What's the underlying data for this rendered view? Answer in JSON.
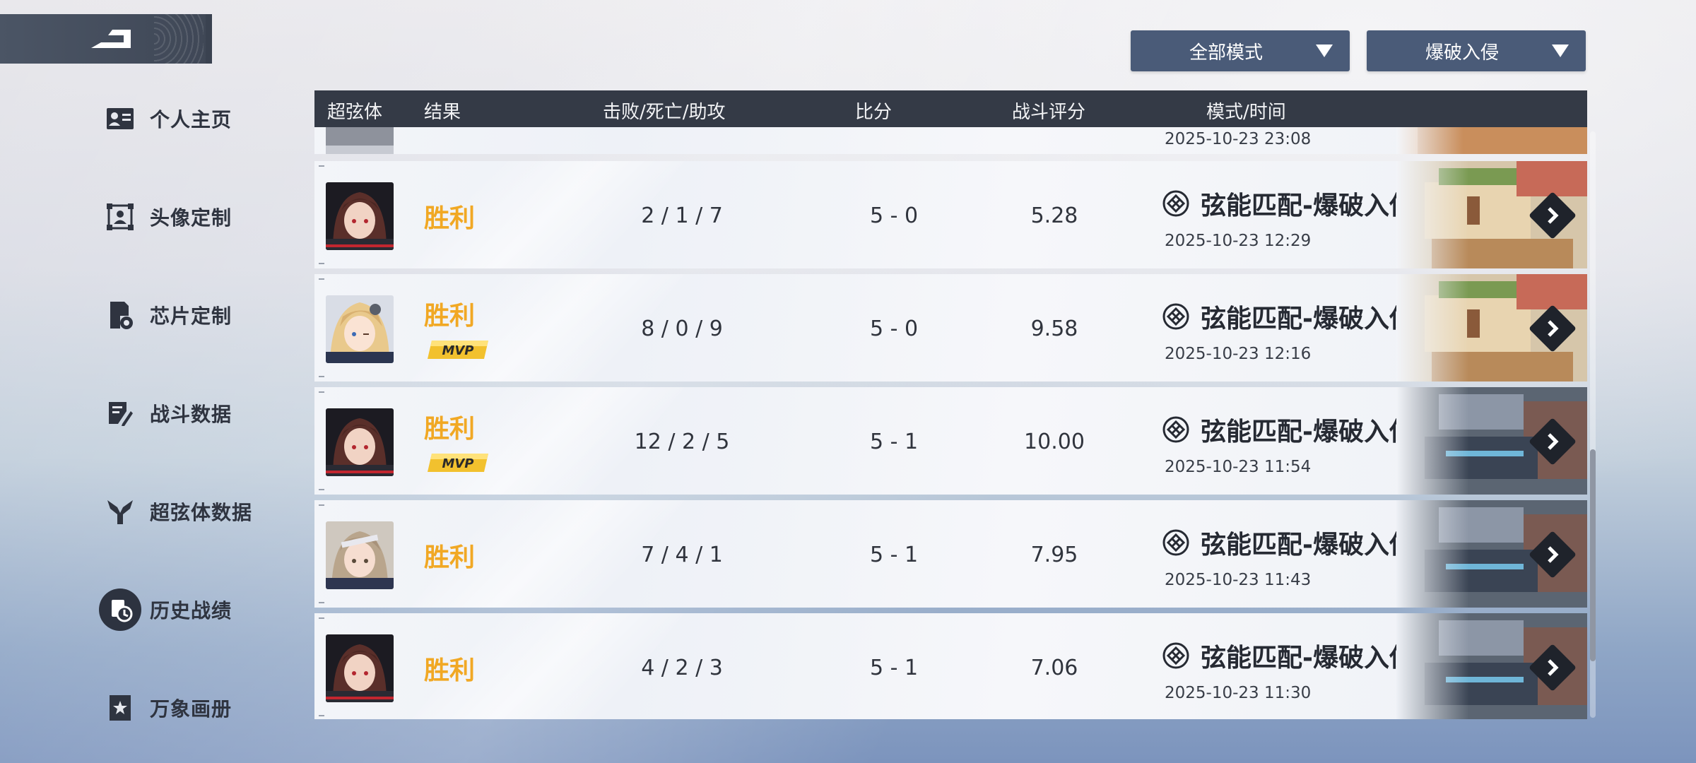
{
  "nav": {
    "back_icon": "back-arrow-icon",
    "items": [
      {
        "label": "个人主页",
        "icon": "profile-card-icon"
      },
      {
        "label": "头像定制",
        "icon": "avatar-frame-icon"
      },
      {
        "label": "芯片定制",
        "icon": "chip-gear-icon"
      },
      {
        "label": "战斗数据",
        "icon": "battle-data-icon"
      },
      {
        "label": "超弦体数据",
        "icon": "character-icon"
      },
      {
        "label": "历史战绩",
        "icon": "history-clock-icon",
        "active": true
      },
      {
        "label": "万象画册",
        "icon": "album-star-icon"
      }
    ]
  },
  "filters": {
    "mode": "全部模式",
    "type": "爆破入侵"
  },
  "table": {
    "headers": {
      "character": "超弦体",
      "result": "结果",
      "kda": "击败/死亡/助攻",
      "score": "比分",
      "rating": "战斗评分",
      "mode_time": "模式/时间"
    },
    "partial_row_time": "2025-10-23 23:08",
    "rows": [
      {
        "result": "胜利",
        "mvp": false,
        "kda": "2 / 1 / 7",
        "score": "5 - 0",
        "rating": "5.28",
        "mode": "弦能匹配-爆破入侵",
        "time": "2025-10-23 12:29",
        "map": "bright",
        "avatar": "dark-hair"
      },
      {
        "result": "胜利",
        "mvp": true,
        "mvp_label": "MVP",
        "kda": "8 / 0 / 9",
        "score": "5 - 0",
        "rating": "9.58",
        "mode": "弦能匹配-爆破入侵",
        "time": "2025-10-23 12:16",
        "map": "bright",
        "avatar": "blonde"
      },
      {
        "result": "胜利",
        "mvp": true,
        "mvp_label": "MVP",
        "kda": "12 / 2 / 5",
        "score": "5 - 1",
        "rating": "10.00",
        "mode": "弦能匹配-爆破入侵",
        "time": "2025-10-23 11:54",
        "map": "dark",
        "avatar": "dark-hair"
      },
      {
        "result": "胜利",
        "mvp": false,
        "kda": "7 / 4 / 1",
        "score": "5 - 1",
        "rating": "7.95",
        "mode": "弦能匹配-爆破入侵",
        "time": "2025-10-23 11:43",
        "map": "dark",
        "avatar": "light-hair"
      },
      {
        "result": "胜利",
        "mvp": false,
        "kda": "4 / 2 / 3",
        "score": "5 - 1",
        "rating": "7.06",
        "mode": "弦能匹配-爆破入侵",
        "time": "2025-10-23 11:30",
        "map": "dark",
        "avatar": "dark-hair"
      }
    ]
  },
  "colors": {
    "win": "#f1a824",
    "header_bg": "#343a46",
    "dropdown_bg": "#4a5b78"
  }
}
